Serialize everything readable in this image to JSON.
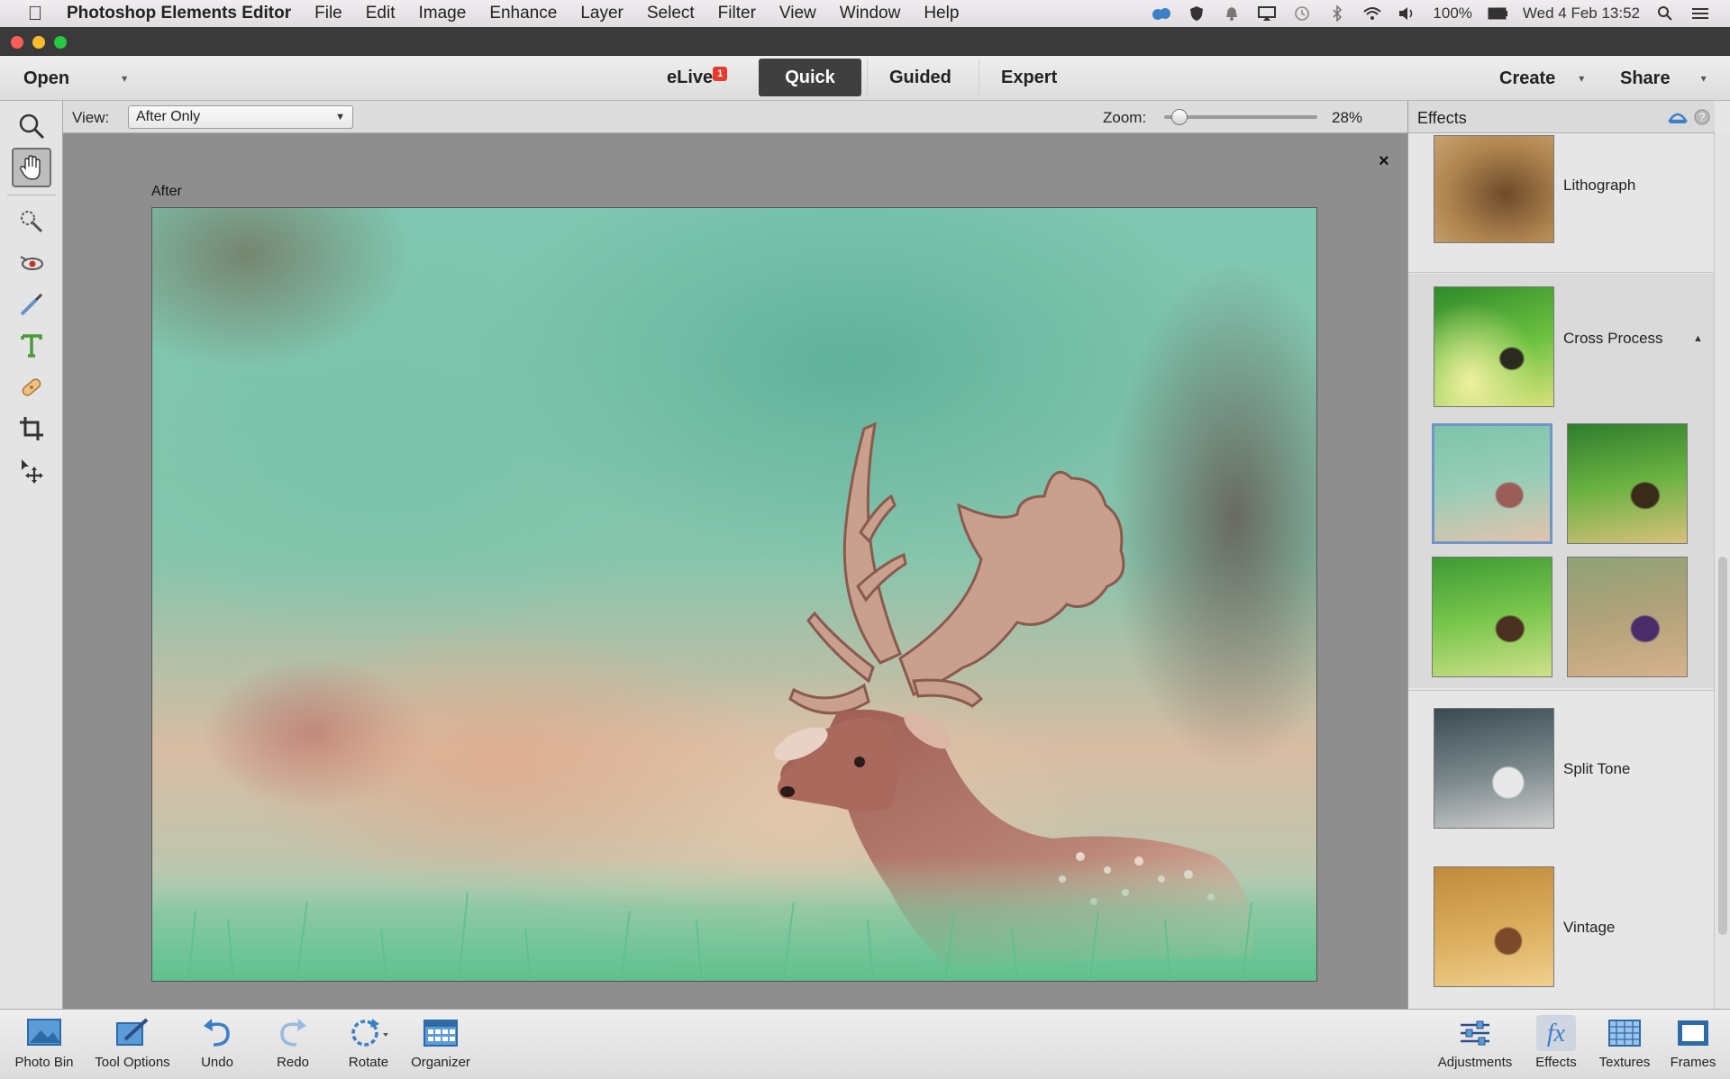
{
  "menubar": {
    "app_name": "Photoshop Elements Editor",
    "items": [
      "File",
      "Edit",
      "Image",
      "Enhance",
      "Layer",
      "Select",
      "Filter",
      "View",
      "Window",
      "Help"
    ],
    "battery": "100%",
    "datetime": "Wed 4 Feb  13:52"
  },
  "appbar": {
    "open_label": "Open",
    "modes": [
      {
        "label": "eLive",
        "badge": "1",
        "active": false
      },
      {
        "label": "Quick",
        "active": true
      },
      {
        "label": "Guided",
        "active": false
      },
      {
        "label": "Expert",
        "active": false
      }
    ],
    "create_label": "Create",
    "share_label": "Share"
  },
  "options": {
    "view_label": "View:",
    "view_value": "After Only",
    "zoom_label": "Zoom:",
    "zoom_value": "28%"
  },
  "document": {
    "label": "After",
    "close_glyph": "×"
  },
  "effects_panel": {
    "title": "Effects",
    "effects": [
      {
        "name": "Lithograph"
      },
      {
        "name": "Cross Process",
        "expanded": true
      },
      {
        "name": "Split Tone"
      },
      {
        "name": "Vintage"
      }
    ]
  },
  "bottombar": {
    "left": [
      {
        "label": "Photo Bin",
        "icon": "photo-bin-icon"
      },
      {
        "label": "Tool Options",
        "icon": "tool-options-icon"
      },
      {
        "label": "Undo",
        "icon": "undo-icon"
      },
      {
        "label": "Redo",
        "icon": "redo-icon"
      },
      {
        "label": "Rotate",
        "icon": "rotate-icon"
      },
      {
        "label": "Organizer",
        "icon": "organizer-icon"
      }
    ],
    "right": [
      {
        "label": "Adjustments",
        "icon": "adjustments-icon"
      },
      {
        "label": "Effects",
        "icon": "fx-icon",
        "active": true
      },
      {
        "label": "Textures",
        "icon": "textures-icon"
      },
      {
        "label": "Frames",
        "icon": "frames-icon"
      }
    ]
  },
  "colors": {
    "active_mode_bg": "#3f3f3f",
    "badge_red": "#e63b2e",
    "selection_blue": "#6f95c9",
    "tool_green": "#4a9a3a",
    "icon_blue": "#3d7fc4"
  }
}
